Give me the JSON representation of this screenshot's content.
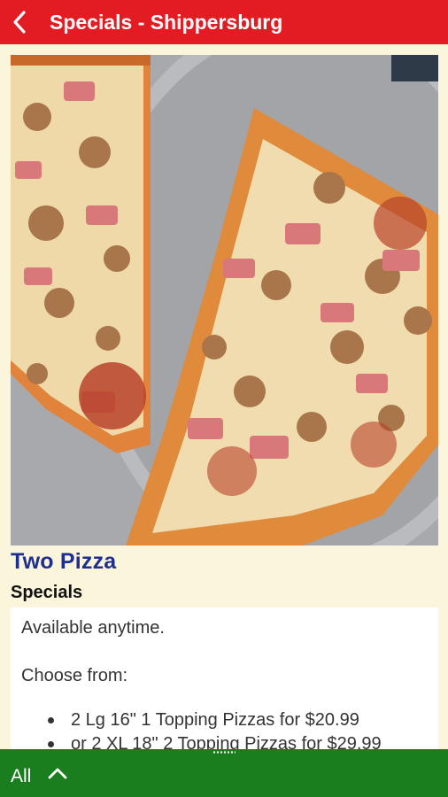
{
  "header": {
    "title": "Specials - Shippersburg",
    "background_color": "#e31b23",
    "back_icon": "chevron-left-icon"
  },
  "item": {
    "image_description_icon": "pizza-photo",
    "title": "Two Pizza",
    "category": "Specials",
    "description": {
      "line1": "Available anytime.",
      "line2": "Choose from:",
      "options": [
        "2 Lg 16\" 1 Topping Pizzas for $20.99",
        "or 2 XL 18\" 2 Topping Pizzas for $29.99"
      ]
    },
    "title_color": "#1f2f8f"
  },
  "bottom_bar": {
    "filter_label": "All",
    "toggle_icon": "chevron-up-icon",
    "background_color": "#1a7d1e"
  },
  "page_background": "#fbf5dc"
}
